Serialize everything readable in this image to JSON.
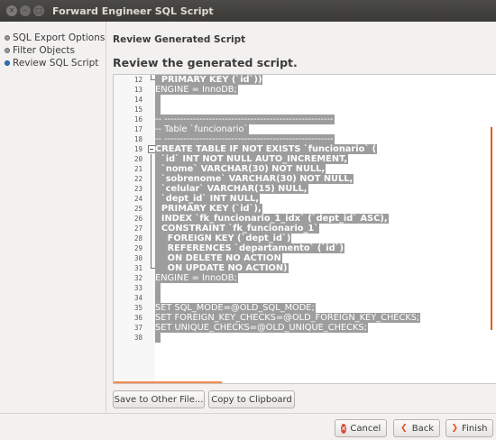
{
  "window": {
    "title": "Forward Engineer SQL Script"
  },
  "sidebar": {
    "items": [
      {
        "label": "SQL Export Options",
        "active": false
      },
      {
        "label": "Filter Objects",
        "active": false
      },
      {
        "label": "Review SQL Script",
        "active": true
      }
    ]
  },
  "main": {
    "crumb": "Review Generated Script",
    "heading": "Review the generated script."
  },
  "editor": {
    "lines": [
      {
        "num": "12",
        "text": "  PRIMARY KEY (`id`))",
        "kw": true
      },
      {
        "num": "13",
        "text": "ENGINE = InnoDB;",
        "kw": false
      },
      {
        "num": "14",
        "text": "",
        "kw": false
      },
      {
        "num": "15",
        "text": "",
        "kw": false
      },
      {
        "num": "16",
        "text": "-- -----------------------------------------------------",
        "kw": false
      },
      {
        "num": "17",
        "text": "-- Table `funcionario`",
        "kw": false
      },
      {
        "num": "18",
        "text": "-- -----------------------------------------------------",
        "kw": false
      },
      {
        "num": "19",
        "text": "CREATE TABLE IF NOT EXISTS `funcionario` (",
        "kw": true
      },
      {
        "num": "20",
        "text": "  `id` INT NOT NULL AUTO_INCREMENT,",
        "kw": true
      },
      {
        "num": "21",
        "text": "  `nome` VARCHAR(30) NOT NULL,",
        "kw": true
      },
      {
        "num": "22",
        "text": "  `sobrenome` VARCHAR(30) NOT NULL,",
        "kw": true
      },
      {
        "num": "23",
        "text": "  `celular` VARCHAR(15) NULL,",
        "kw": true
      },
      {
        "num": "24",
        "text": "  `dept_id` INT NULL,",
        "kw": true
      },
      {
        "num": "25",
        "text": "  PRIMARY KEY (`id`),",
        "kw": true
      },
      {
        "num": "26",
        "text": "  INDEX `fk_funcionario_1_idx` (`dept_id` ASC),",
        "kw": true
      },
      {
        "num": "27",
        "text": "  CONSTRAINT `fk_funcionario_1`",
        "kw": true
      },
      {
        "num": "28",
        "text": "    FOREIGN KEY (`dept_id`)",
        "kw": true
      },
      {
        "num": "29",
        "text": "    REFERENCES `departamento` (`id`)",
        "kw": true
      },
      {
        "num": "30",
        "text": "    ON DELETE NO ACTION",
        "kw": true
      },
      {
        "num": "31",
        "text": "    ON UPDATE NO ACTION)",
        "kw": true
      },
      {
        "num": "32",
        "text": "ENGINE = InnoDB;",
        "kw": false
      },
      {
        "num": "33",
        "text": "",
        "kw": false
      },
      {
        "num": "34",
        "text": "",
        "kw": false
      },
      {
        "num": "35",
        "text": "SET SQL_MODE=@OLD_SQL_MODE;",
        "kw": false
      },
      {
        "num": "36",
        "text": "SET FOREIGN_KEY_CHECKS=@OLD_FOREIGN_KEY_CHECKS;",
        "kw": false
      },
      {
        "num": "37",
        "text": "SET UNIQUE_CHECKS=@OLD_UNIQUE_CHECKS;",
        "kw": false
      },
      {
        "num": "38",
        "text": "",
        "kw": false
      }
    ]
  },
  "actions": {
    "save_label": "Save to Other File...",
    "copy_label": "Copy to Clipboard",
    "cancel_label": "Cancel",
    "back_label": "Back",
    "finish_label": "Finish"
  },
  "icons": {
    "close": "close-icon",
    "minimize": "minimize-icon",
    "maximize": "maximize-icon",
    "cancel": "cancel-icon",
    "back": "back-arrow-icon",
    "finish": "forward-arrow-icon"
  },
  "colors": {
    "selection": "#9d9d9d",
    "accent": "#e45b14",
    "active_bullet": "#2d72b8"
  }
}
